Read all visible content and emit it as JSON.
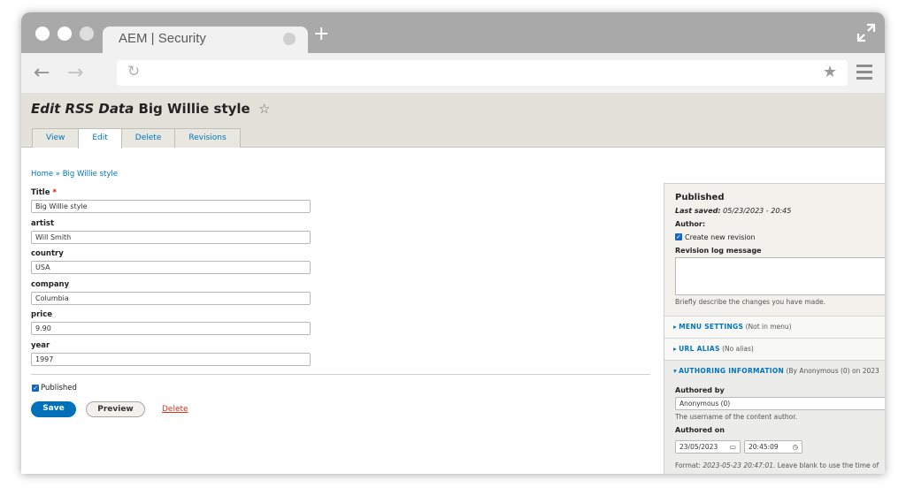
{
  "browser": {
    "tab_title": "AEM | Security",
    "new_tab": "+"
  },
  "page": {
    "title_italic": "Edit RSS Data",
    "title_bold": "Big Willie style",
    "star": "☆",
    "tabs": [
      {
        "label": "View"
      },
      {
        "label": "Edit"
      },
      {
        "label": "Delete"
      },
      {
        "label": "Revisions"
      }
    ],
    "breadcrumb": "Home » Big Willie style"
  },
  "form": {
    "title_label": "Title",
    "title_required": "*",
    "title_value": "Big Willie style",
    "artist_label": "artist",
    "artist_value": "Will Smith",
    "country_label": "country",
    "country_value": "USA",
    "company_label": "company",
    "company_value": "Columbia",
    "price_label": "price",
    "price_value": "9.90",
    "year_label": "year",
    "year_value": "1997",
    "published_label": "Published",
    "save_label": "Save",
    "preview_label": "Preview",
    "delete_label": "Delete"
  },
  "sidebar": {
    "status": "Published",
    "last_saved_label": "Last saved:",
    "last_saved_value": "05/23/2023 - 20:45",
    "author_label": "Author:",
    "create_revision_label": "Create new revision",
    "revision_log_label": "Revision log message",
    "revision_hint": "Briefly describe the changes you have made.",
    "menu_settings": "MENU SETTINGS",
    "menu_settings_sub": "(Not in menu)",
    "url_alias": "URL ALIAS",
    "url_alias_sub": "(No alias)",
    "authoring_info": "AUTHORING INFORMATION",
    "authoring_info_sub": "(By Anonymous (0) on 2023",
    "authored_by_label": "Authored by",
    "authored_by_value": "Anonymous (0)",
    "authored_by_hint": "The username of the content author.",
    "authored_on_label": "Authored on",
    "date_value": "23/05/2023",
    "time_value": "20:45:09",
    "format_label": "Format:",
    "format_value": "2023-05-23 20:47:01.",
    "format_hint": "Leave blank to use the time of"
  }
}
